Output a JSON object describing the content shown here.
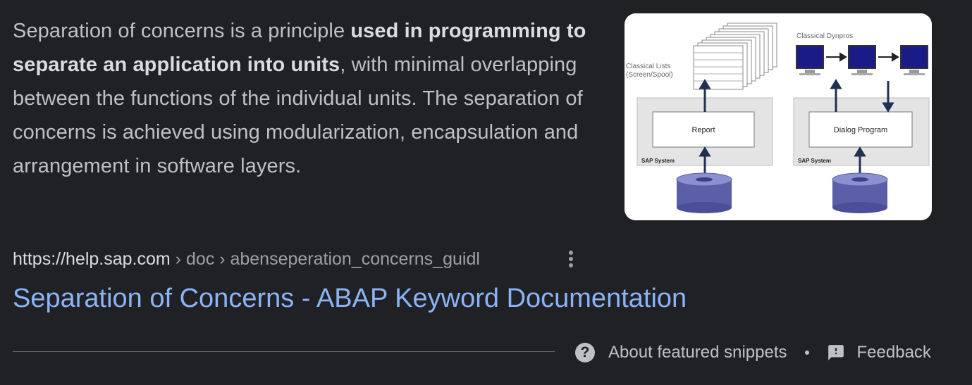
{
  "snippet": {
    "text_before": "Separation of concerns is a principle ",
    "text_bold": "used in programming to separate an application into units",
    "text_after": ", with minimal overlapping between the functions of the individual units. The separation of concerns is achieved using modularization, encapsulation and arrangement in software layers."
  },
  "thumbnail": {
    "left_label_line1": "Classical Lists",
    "left_label_line2": "(Screen/Spool)",
    "right_label": "Classical Dynpros",
    "left_box_label": "Report",
    "right_box_label": "Dialog Program",
    "left_system_label": "SAP System",
    "right_system_label": "SAP System"
  },
  "result": {
    "domain": "https://help.sap.com",
    "path": " › doc › abenseperation_concerns_guidl",
    "more_icon": "more-vert-icon",
    "title": "Separation of Concerns - ABAP Keyword Documentation"
  },
  "footer": {
    "help_icon": "help-circle-icon",
    "help_glyph": "?",
    "about_label": "About featured snippets",
    "feedback_icon": "feedback-icon",
    "feedback_label": "Feedback"
  },
  "colors": {
    "background": "#202124",
    "text": "#bdc1c6",
    "link": "#8ab4f8",
    "secondary": "#9aa0a6"
  }
}
